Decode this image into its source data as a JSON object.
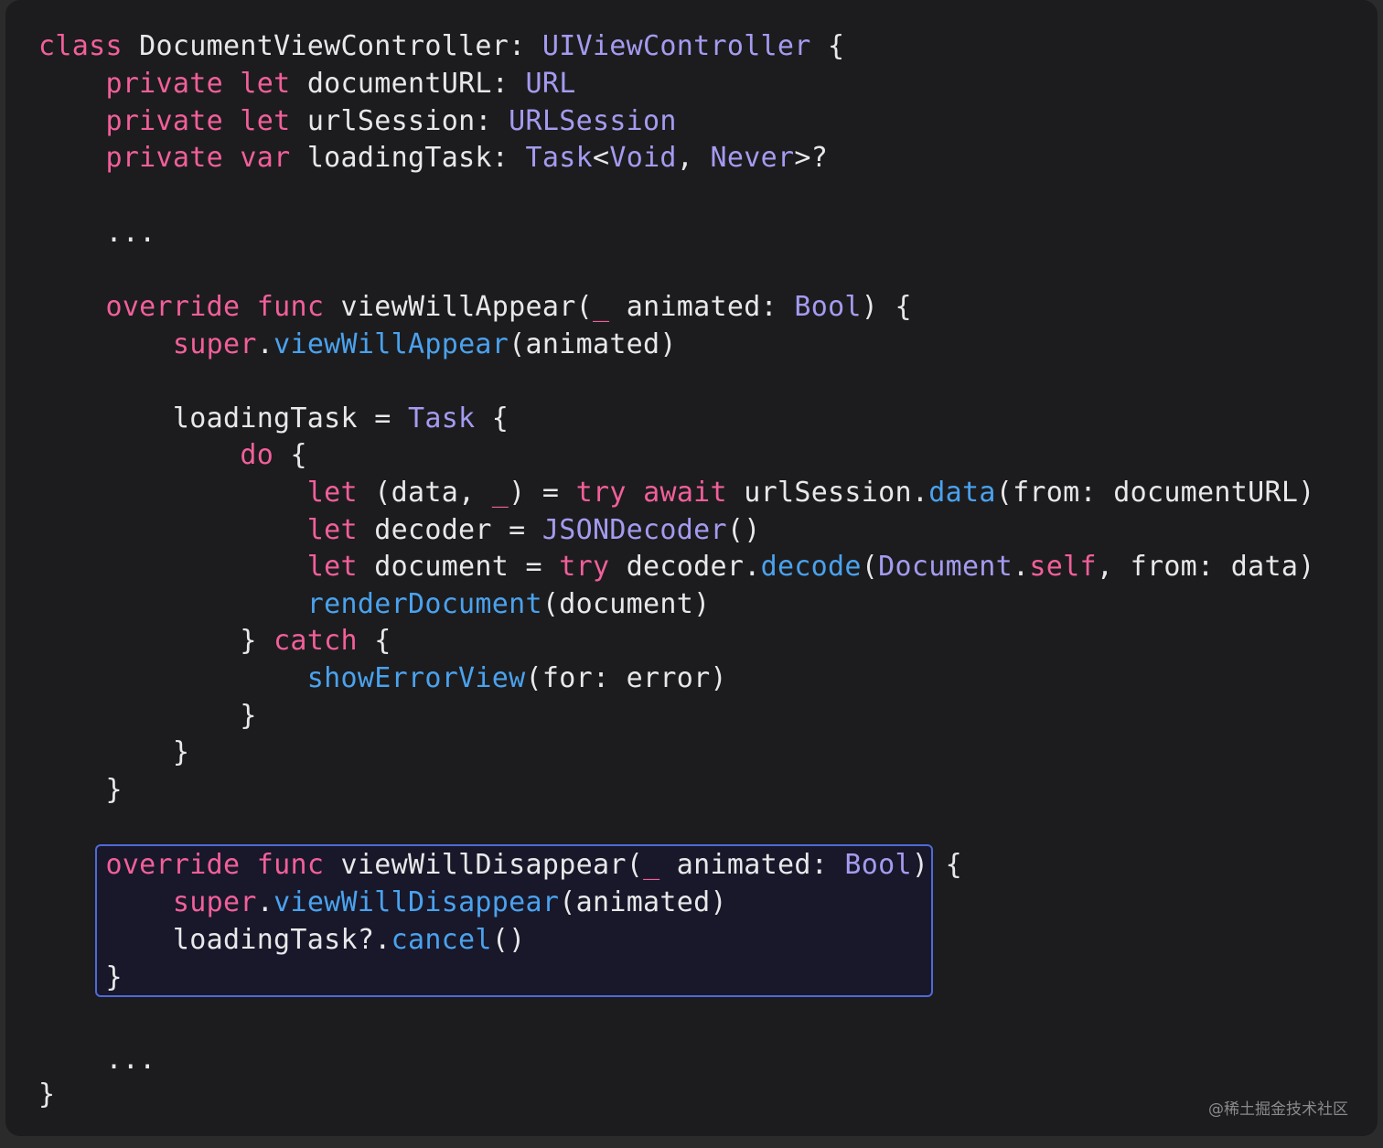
{
  "colors": {
    "keyword": "#f25f9a",
    "type": "#a49bf0",
    "method": "#4aa2ee",
    "plain": "#e8e8ea",
    "background": "#1c1c1e",
    "highlight_border": "#4f6ad8"
  },
  "code": [
    [
      [
        "class",
        "kw"
      ],
      [
        " DocumentViewController: ",
        "pl"
      ],
      [
        "UIViewController",
        "ty"
      ],
      [
        " {",
        "pl"
      ]
    ],
    [
      [
        "    ",
        "pl"
      ],
      [
        "private",
        "kw"
      ],
      [
        " ",
        "pl"
      ],
      [
        "let",
        "kw"
      ],
      [
        " documentURL: ",
        "pl"
      ],
      [
        "URL",
        "ty"
      ]
    ],
    [
      [
        "    ",
        "pl"
      ],
      [
        "private",
        "kw"
      ],
      [
        " ",
        "pl"
      ],
      [
        "let",
        "kw"
      ],
      [
        " urlSession: ",
        "pl"
      ],
      [
        "URLSession",
        "ty"
      ]
    ],
    [
      [
        "    ",
        "pl"
      ],
      [
        "private",
        "kw"
      ],
      [
        " ",
        "pl"
      ],
      [
        "var",
        "kw"
      ],
      [
        " loadingTask: ",
        "pl"
      ],
      [
        "Task",
        "ty"
      ],
      [
        "<",
        "pl"
      ],
      [
        "Void",
        "ty"
      ],
      [
        ", ",
        "pl"
      ],
      [
        "Never",
        "ty"
      ],
      [
        ">?",
        "pl"
      ]
    ],
    [],
    [
      [
        "    ...",
        "pl"
      ]
    ],
    [],
    [
      [
        "    ",
        "pl"
      ],
      [
        "override",
        "kw"
      ],
      [
        " ",
        "pl"
      ],
      [
        "func",
        "kw"
      ],
      [
        " viewWillAppear(",
        "pl"
      ],
      [
        "_",
        "kw"
      ],
      [
        " animated: ",
        "pl"
      ],
      [
        "Bool",
        "ty"
      ],
      [
        ") {",
        "pl"
      ]
    ],
    [
      [
        "        ",
        "pl"
      ],
      [
        "super",
        "kw"
      ],
      [
        ".",
        "pl"
      ],
      [
        "viewWillAppear",
        "fn"
      ],
      [
        "(animated)",
        "pl"
      ]
    ],
    [],
    [
      [
        "        loadingTask = ",
        "pl"
      ],
      [
        "Task",
        "ty"
      ],
      [
        " {",
        "pl"
      ]
    ],
    [
      [
        "            ",
        "pl"
      ],
      [
        "do",
        "kw"
      ],
      [
        " {",
        "pl"
      ]
    ],
    [
      [
        "                ",
        "pl"
      ],
      [
        "let",
        "kw"
      ],
      [
        " (data, ",
        "pl"
      ],
      [
        "_",
        "kw"
      ],
      [
        ") = ",
        "pl"
      ],
      [
        "try",
        "kw"
      ],
      [
        " ",
        "pl"
      ],
      [
        "await",
        "kw"
      ],
      [
        " urlSession.",
        "pl"
      ],
      [
        "data",
        "fn"
      ],
      [
        "(from: documentURL)",
        "pl"
      ]
    ],
    [
      [
        "                ",
        "pl"
      ],
      [
        "let",
        "kw"
      ],
      [
        " decoder = ",
        "pl"
      ],
      [
        "JSONDecoder",
        "ty"
      ],
      [
        "()",
        "pl"
      ]
    ],
    [
      [
        "                ",
        "pl"
      ],
      [
        "let",
        "kw"
      ],
      [
        " document = ",
        "pl"
      ],
      [
        "try",
        "kw"
      ],
      [
        " decoder.",
        "pl"
      ],
      [
        "decode",
        "fn"
      ],
      [
        "(",
        "pl"
      ],
      [
        "Document",
        "ty"
      ],
      [
        ".",
        "pl"
      ],
      [
        "self",
        "kw"
      ],
      [
        ", from: data)",
        "pl"
      ]
    ],
    [
      [
        "                ",
        "pl"
      ],
      [
        "renderDocument",
        "fn"
      ],
      [
        "(document)",
        "pl"
      ]
    ],
    [
      [
        "            } ",
        "pl"
      ],
      [
        "catch",
        "kw"
      ],
      [
        " {",
        "pl"
      ]
    ],
    [
      [
        "                ",
        "pl"
      ],
      [
        "showErrorView",
        "fn"
      ],
      [
        "(for: error)",
        "pl"
      ]
    ],
    [
      [
        "            }",
        "pl"
      ]
    ],
    [
      [
        "        }",
        "pl"
      ]
    ],
    [
      [
        "    }",
        "pl"
      ]
    ],
    [],
    [
      [
        "    ",
        "pl"
      ],
      [
        "override",
        "kw"
      ],
      [
        " ",
        "pl"
      ],
      [
        "func",
        "kw"
      ],
      [
        " viewWillDisappear(",
        "pl"
      ],
      [
        "_",
        "kw"
      ],
      [
        " animated: ",
        "pl"
      ],
      [
        "Bool",
        "ty"
      ],
      [
        ") {",
        "pl"
      ]
    ],
    [
      [
        "        ",
        "pl"
      ],
      [
        "super",
        "kw"
      ],
      [
        ".",
        "pl"
      ],
      [
        "viewWillDisappear",
        "fn"
      ],
      [
        "(animated)",
        "pl"
      ]
    ],
    [
      [
        "        loadingTask?.",
        "pl"
      ],
      [
        "cancel",
        "fn"
      ],
      [
        "()",
        "pl"
      ]
    ],
    [
      [
        "    }",
        "pl"
      ]
    ],
    [],
    [
      [
        "    ...",
        "pl"
      ]
    ],
    [
      [
        "}",
        "pl"
      ]
    ]
  ],
  "watermark": "@稀土掘金技术社区"
}
